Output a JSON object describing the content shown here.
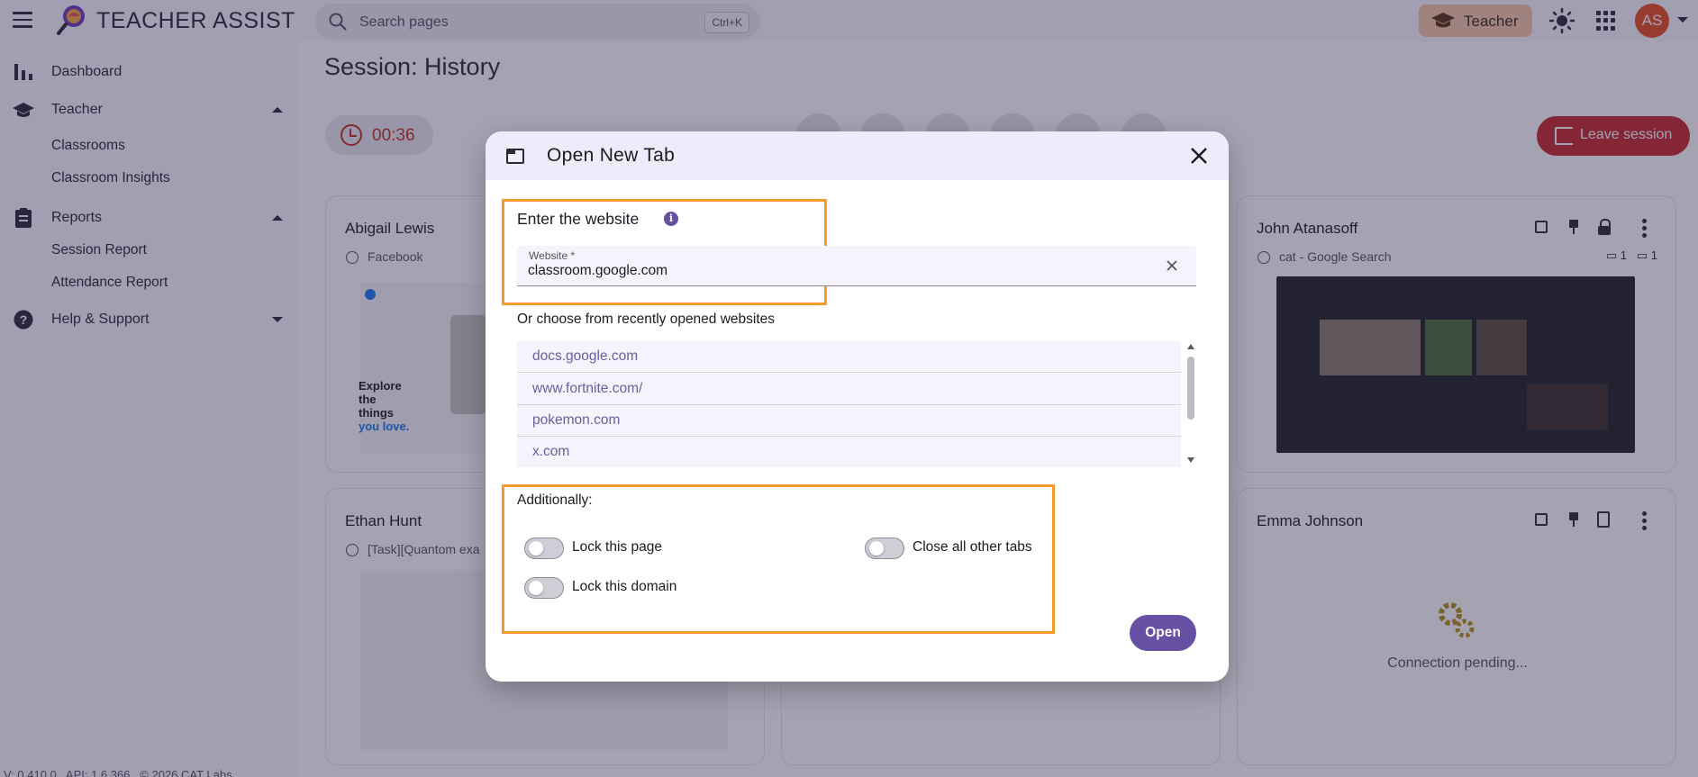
{
  "app": {
    "brand": "TEACHER ASSIST",
    "search_placeholder": "Search pages",
    "search_shortcut": "Ctrl+K",
    "role_label": "Teacher",
    "avatar_initials": "AS",
    "version_text": "V: 0.410.0 , API: 1.6.366 , © 2026 CAT Labs"
  },
  "sidebar": {
    "dashboard": "Dashboard",
    "teacher": "Teacher",
    "classrooms": "Classrooms",
    "classroom_insights": "Classroom Insights",
    "reports": "Reports",
    "session_report": "Session Report",
    "attendance_report": "Attendance Report",
    "help_support": "Help & Support"
  },
  "session": {
    "title": "Session: History",
    "timer": "00:36",
    "leave_label": "Leave session"
  },
  "students": [
    {
      "name": "Abigail Lewis",
      "site": "Facebook"
    },
    {
      "name": "John Atanasoff",
      "site": "cat - Google Search",
      "messages": "1",
      "tabs": "1"
    },
    {
      "name": "Ethan Hunt",
      "site": "[Task][Quantom exa"
    },
    {
      "name": "Emma Johnson",
      "status": "Connection pending..."
    }
  ],
  "thumbnail_text": {
    "explore_line1": "Explore",
    "explore_line2": "the",
    "explore_line3": "things",
    "explore_line4": "you love."
  },
  "dialog": {
    "title": "Open New Tab",
    "enter_label": "Enter the website",
    "info_glyph": "i",
    "field_label": "Website *",
    "field_value": "classroom.google.com",
    "recent_label": "Or choose from recently opened websites",
    "recent_sites": [
      "docs.google.com",
      "www.fortnite.com/",
      "pokemon.com",
      "x.com"
    ],
    "additionally_label": "Additionally:",
    "lock_page": "Lock this page",
    "close_tabs": "Close all other tabs",
    "lock_domain": "Lock this domain",
    "open_label": "Open"
  },
  "colors": {
    "primary": "#6650a4",
    "highlight": "#f59a2e",
    "danger": "#c62828",
    "scrim": "#2c2848"
  }
}
